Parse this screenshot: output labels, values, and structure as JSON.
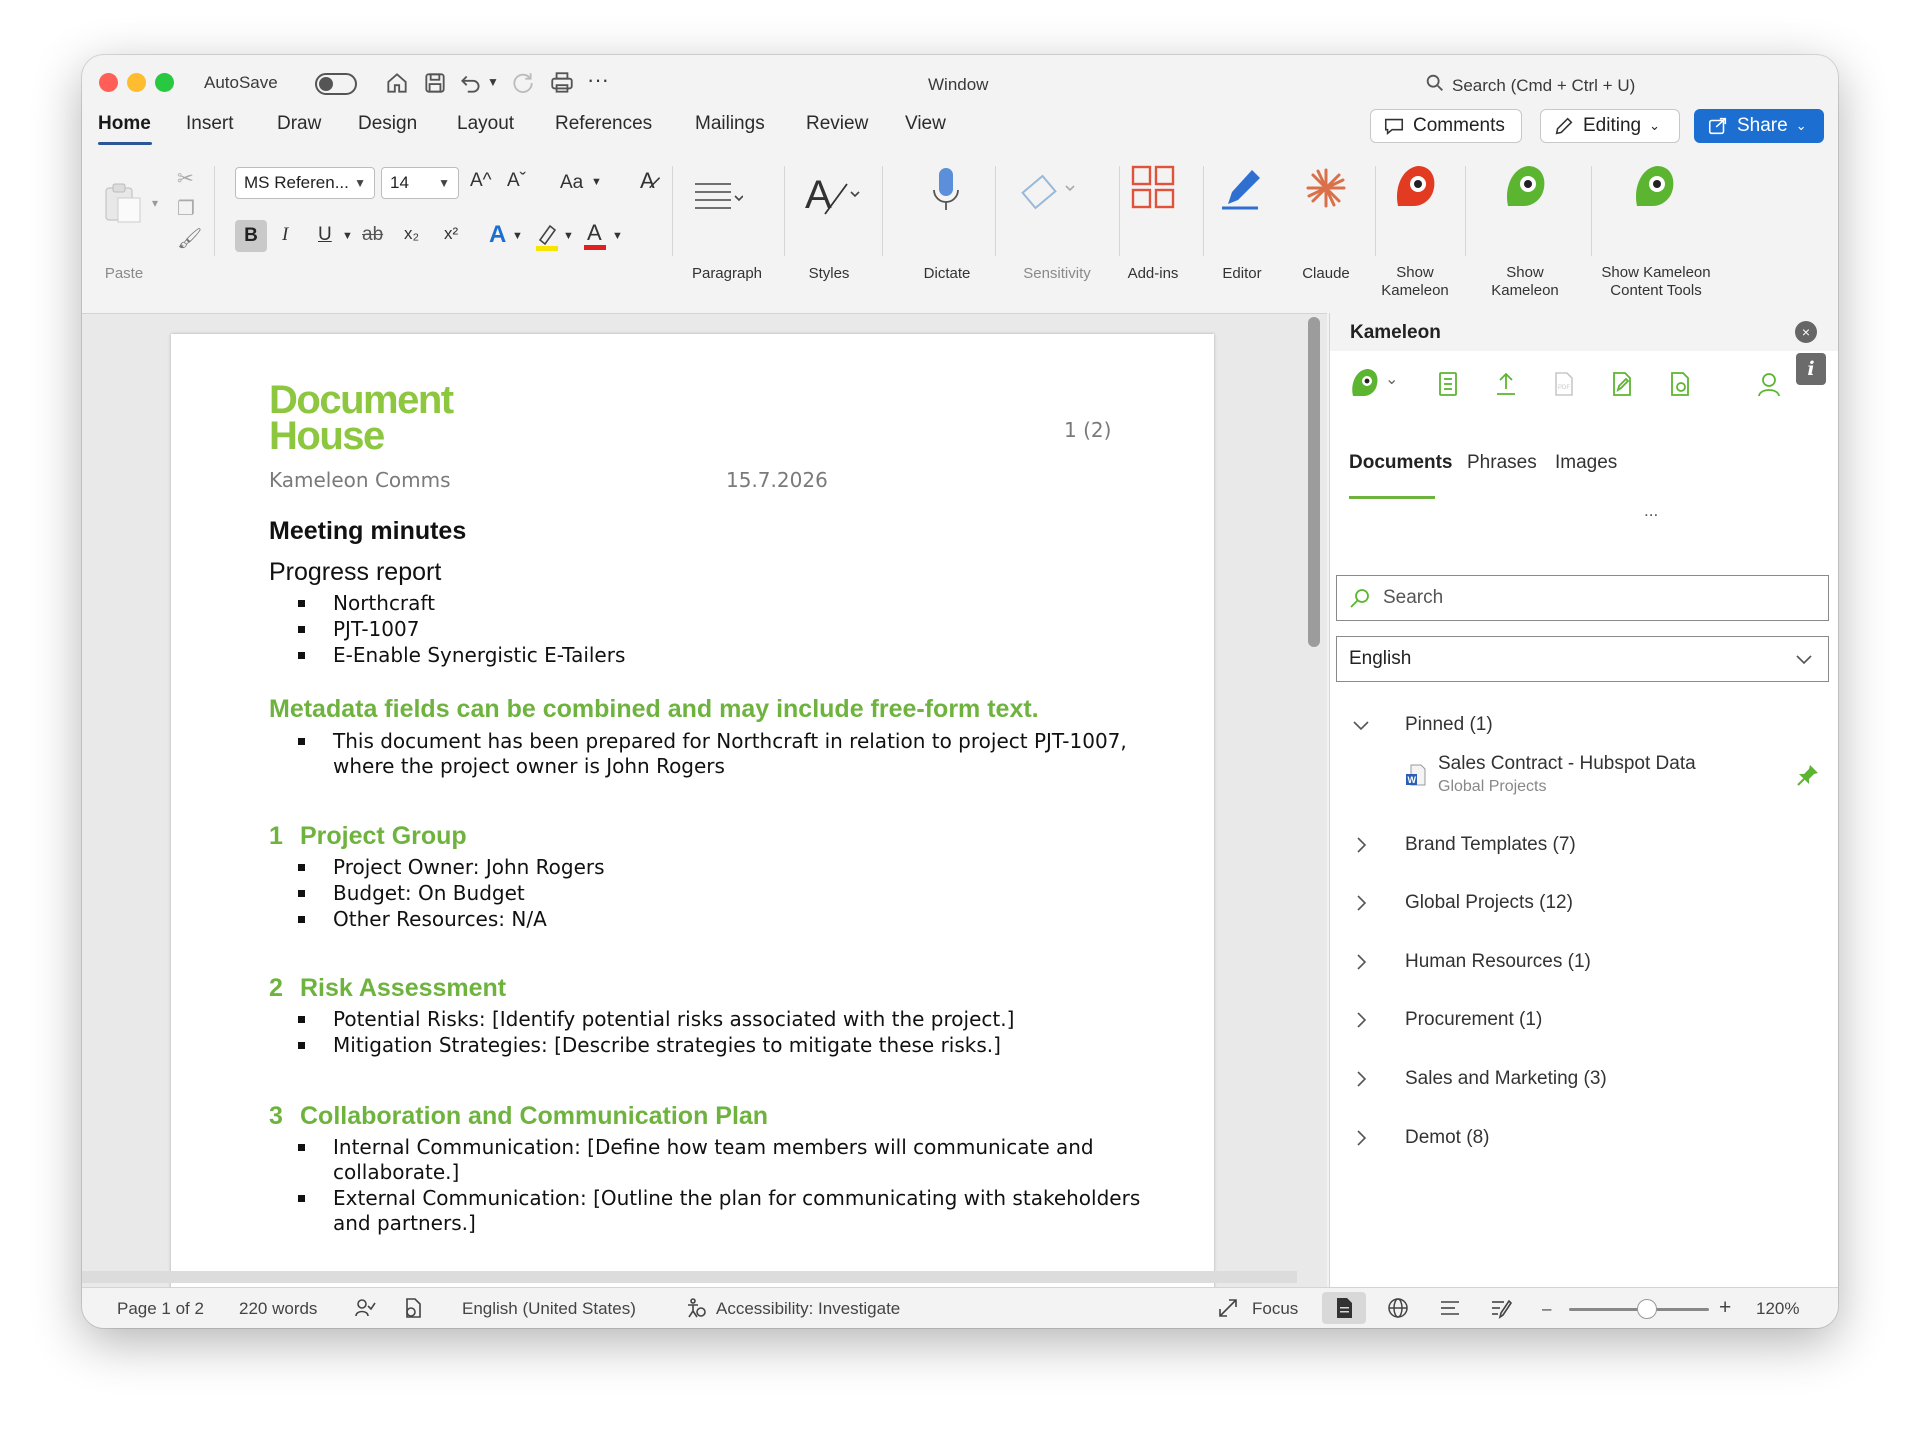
{
  "titlebar": {
    "autosave_label": "AutoSave",
    "window_title": "Window",
    "search_placeholder": "Search (Cmd + Ctrl + U)"
  },
  "tabs": [
    "Home",
    "Insert",
    "Draw",
    "Design",
    "Layout",
    "References",
    "Mailings",
    "Review",
    "View"
  ],
  "actions": {
    "comments": "Comments",
    "editing": "Editing",
    "share": "Share"
  },
  "ribbon": {
    "paste": "Paste",
    "font_name": "MS Referen...",
    "font_size": "14",
    "grow_font": "A^",
    "shrink_font": "Aˇ",
    "change_case": "Aa",
    "bold": "B",
    "italic": "I",
    "underline": "U",
    "strike": "ab",
    "subscript": "x₂",
    "superscript": "x²",
    "paragraph": "Paragraph",
    "styles": "Styles",
    "dictate": "Dictate",
    "sensitivity": "Sensitivity",
    "addins": "Add-ins",
    "editor": "Editor",
    "claude": "Claude",
    "show_kameleon_1": [
      "Show",
      "Kameleon"
    ],
    "show_kameleon_2": [
      "Show",
      "Kameleon"
    ],
    "show_kameleon_content": [
      "Show Kameleon",
      "Content Tools"
    ]
  },
  "colors": {
    "accent_green": "#6fb33f",
    "logo_green": "#8dc63f",
    "share_blue": "#1c6fd1",
    "font_color_red": "#e02020",
    "highlight_yellow": "#f7e400"
  },
  "document": {
    "logo_line1": "Document",
    "logo_line2": "House",
    "page_label": "1 (2)",
    "author": "Kameleon Comms",
    "date": "15.7.2026",
    "heading1": "Meeting minutes",
    "heading2": "Progress report",
    "meta_bullets": [
      "Northcraft",
      "PJT-1007",
      "E-Enable Synergistic E-Tailers"
    ],
    "metadata_heading": "Metadata fields can be combined and may include free-form text.",
    "metadata_bullets": [
      "This document has been prepared for Northcraft in relation to project PJT-1007, where the project owner is John Rogers"
    ],
    "sections": [
      {
        "num": "1",
        "title": "Project Group",
        "bullets": [
          "Project Owner: John Rogers",
          "Budget: On Budget",
          "Other Resources: N/A"
        ]
      },
      {
        "num": "2",
        "title": "Risk Assessment",
        "bullets": [
          "Potential Risks: [Identify potential risks associated with the project.]",
          "Mitigation Strategies: [Describe strategies to mitigate these risks.]"
        ]
      },
      {
        "num": "3",
        "title": "Collaboration and Communication Plan",
        "bullets": [
          "Internal Communication: [Define how team members will communicate and collaborate.]",
          "External Communication: [Outline the plan for communicating with stakeholders and partners.]"
        ]
      }
    ]
  },
  "panel": {
    "title": "Kameleon",
    "close_symbol": "×",
    "info_symbol": "i",
    "tabs": [
      "Documents",
      "Phrases",
      "Images"
    ],
    "more": "...",
    "search_placeholder": "Search",
    "language": "English",
    "pinned": {
      "label": "Pinned (1)",
      "item_title": "Sales Contract - Hubspot Data",
      "item_sub": "Global Projects"
    },
    "folders": [
      "Brand Templates (7)",
      "Global Projects (12)",
      "Human Resources (1)",
      "Procurement (1)",
      "Sales and Marketing (3)",
      "Demot (8)"
    ]
  },
  "statusbar": {
    "page": "Page 1 of 2",
    "words": "220 words",
    "language": "English (United States)",
    "accessibility": "Accessibility: Investigate",
    "focus": "Focus",
    "zoom_minus": "–",
    "zoom_plus": "+",
    "zoom": "120%",
    "zoom_level": 0.5
  }
}
